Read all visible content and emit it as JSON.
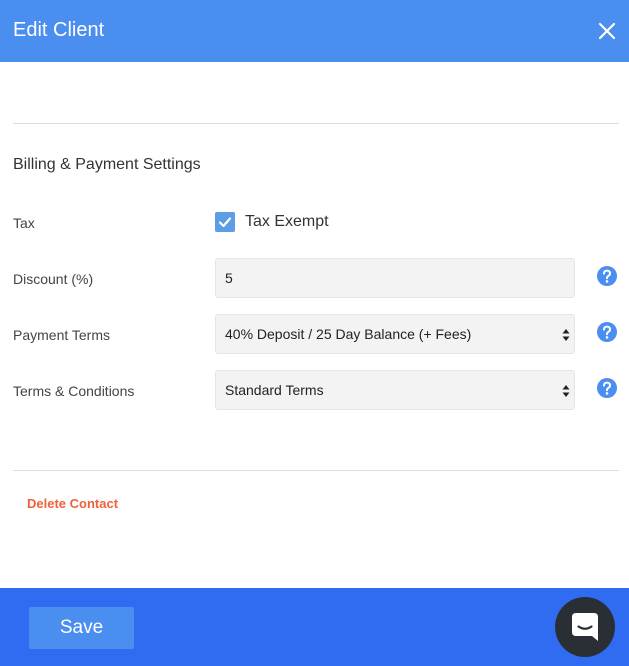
{
  "header": {
    "title": "Edit Client",
    "close_icon": "close-icon"
  },
  "billing": {
    "section_title": "Billing & Payment Settings",
    "tax": {
      "label": "Tax",
      "checkbox_label": "Tax Exempt",
      "checked": true
    },
    "discount": {
      "label": "Discount (%)",
      "value": "5"
    },
    "payment_terms": {
      "label": "Payment Terms",
      "selected": "40% Deposit / 25 Day Balance (+ Fees)"
    },
    "terms_conditions": {
      "label": "Terms & Conditions",
      "selected": "Standard Terms"
    },
    "help_icon": "help-circle-icon"
  },
  "actions": {
    "delete_label": "Delete Contact",
    "save_label": "Save"
  },
  "chat": {
    "icon": "chat-bubble-icon"
  },
  "colors": {
    "header_bg": "#4a8ef0",
    "footer_bg": "#2f6cf2",
    "accent": "#5b9ee6",
    "danger": "#f0603a",
    "chat_bg": "#2a2f36"
  }
}
